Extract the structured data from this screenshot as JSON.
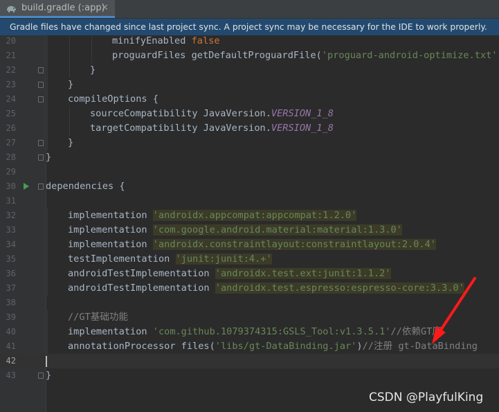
{
  "tab": {
    "title": "build.gradle (:app)",
    "close_glyph": "✕",
    "icon": "gradle-elephant-icon"
  },
  "banner": {
    "message": "Gradle files have changed since last project sync. A project sync may be necessary for the IDE to work properly."
  },
  "lines": [
    {
      "n": "20",
      "indent": 3,
      "tokens": [
        [
          "",
          "minifyEnabled "
        ],
        [
          "kw",
          "false"
        ]
      ]
    },
    {
      "n": "21",
      "indent": 3,
      "tokens": [
        [
          "",
          "proguardFiles getDefaultProguardFile("
        ],
        [
          "str",
          "'proguard-android-optimize.txt'"
        ],
        [
          "",
          "),"
        ]
      ]
    },
    {
      "n": "22",
      "indent": 2,
      "fold": true,
      "tokens": [
        [
          "",
          "}"
        ]
      ]
    },
    {
      "n": "23",
      "indent": 1,
      "fold": true,
      "tokens": [
        [
          "",
          "}"
        ]
      ]
    },
    {
      "n": "24",
      "indent": 1,
      "fold": true,
      "tokens": [
        [
          "",
          "compileOptions {"
        ]
      ]
    },
    {
      "n": "25",
      "indent": 2,
      "tokens": [
        [
          "",
          "sourceCompatibility JavaVersion."
        ],
        [
          "const",
          "VERSION_1_8"
        ]
      ]
    },
    {
      "n": "26",
      "indent": 2,
      "tokens": [
        [
          "",
          "targetCompatibility JavaVersion."
        ],
        [
          "const",
          "VERSION_1_8"
        ]
      ]
    },
    {
      "n": "27",
      "indent": 1,
      "fold": true,
      "tokens": [
        [
          "",
          "}"
        ]
      ]
    },
    {
      "n": "28",
      "indent": 0,
      "fold": true,
      "tokens": [
        [
          "",
          "}"
        ]
      ]
    },
    {
      "n": "29",
      "indent": 0,
      "tokens": []
    },
    {
      "n": "30",
      "indent": 0,
      "fold": true,
      "run": true,
      "tokens": [
        [
          "",
          "dependencies {"
        ]
      ]
    },
    {
      "n": "31",
      "indent": 0,
      "tokens": []
    },
    {
      "n": "32",
      "indent": 1,
      "tokens": [
        [
          "",
          "implementation "
        ],
        [
          "str hl",
          "'androidx.appcompat:appcompat:1.2.0'"
        ]
      ]
    },
    {
      "n": "33",
      "indent": 1,
      "tokens": [
        [
          "",
          "implementation "
        ],
        [
          "str hl",
          "'com.google.android.material:material:1.3.0'"
        ]
      ]
    },
    {
      "n": "34",
      "indent": 1,
      "tokens": [
        [
          "",
          "implementation "
        ],
        [
          "str hl",
          "'androidx.constraintlayout:constraintlayout:2.0.4'"
        ]
      ]
    },
    {
      "n": "35",
      "indent": 1,
      "tokens": [
        [
          "",
          "testImplementation "
        ],
        [
          "str hl",
          "'junit:junit:4.+'"
        ]
      ]
    },
    {
      "n": "36",
      "indent": 1,
      "tokens": [
        [
          "",
          "androidTestImplementation "
        ],
        [
          "str hl",
          "'androidx.test.ext:junit:1.1.2'"
        ]
      ]
    },
    {
      "n": "37",
      "indent": 1,
      "tokens": [
        [
          "",
          "androidTestImplementation "
        ],
        [
          "str hl",
          "'androidx.test.espresso:espresso-core:3.3.0'"
        ]
      ]
    },
    {
      "n": "38",
      "indent": 0,
      "tokens": []
    },
    {
      "n": "39",
      "indent": 1,
      "tokens": [
        [
          "cmt",
          "//GT基础功能"
        ]
      ]
    },
    {
      "n": "40",
      "indent": 1,
      "tokens": [
        [
          "",
          "implementation "
        ],
        [
          "str",
          "'com.github.1079374315:GSLS_Tool:v1.3.5.1'"
        ],
        [
          "cmt",
          "//依赖GT库"
        ]
      ]
    },
    {
      "n": "41",
      "indent": 1,
      "tokens": [
        [
          "",
          "annotationProcessor files("
        ],
        [
          "str",
          "'libs/gt-DataBinding.jar'"
        ],
        [
          "",
          ")"
        ],
        [
          "cmt",
          "//注册 gt-DataBinding"
        ]
      ]
    },
    {
      "n": "42",
      "indent": 0,
      "current": true,
      "tokens": []
    },
    {
      "n": "43",
      "indent": 0,
      "fold": true,
      "tokens": [
        [
          "",
          "}"
        ]
      ]
    }
  ],
  "annotation": {
    "type": "red-arrow",
    "points_to_line": "41",
    "color": "#ff1a1a"
  },
  "watermark": "CSDN @PlayfulKing"
}
